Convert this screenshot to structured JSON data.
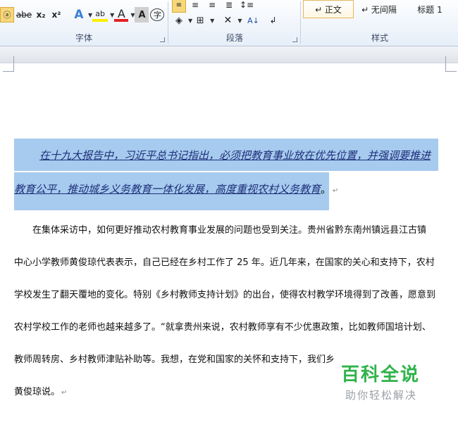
{
  "ribbon": {
    "font_group": {
      "label": "字体",
      "buttons": [
        {
          "name": "char-case-button",
          "text": "abc"
        },
        {
          "name": "strikethrough-button",
          "text": "abe"
        },
        {
          "name": "subscript-button",
          "text": "x₂"
        },
        {
          "name": "superscript-button",
          "text": "x²"
        },
        {
          "name": "text-effects-button",
          "text": "A"
        },
        {
          "name": "highlight-button",
          "text": "ab"
        },
        {
          "name": "font-color-button",
          "text": "A"
        },
        {
          "name": "char-shading-button",
          "text": "A"
        },
        {
          "name": "enclose-char-button",
          "text": "字"
        }
      ]
    },
    "paragraph_group": {
      "label": "段落"
    },
    "styles_group": {
      "label": "样式",
      "items": [
        "↵ 正文",
        "↵ 无间隔",
        "标题 1"
      ]
    }
  },
  "document": {
    "selected_line1": "在十九大报告中，习近平总书记指出，必须把教育事业放在优先位置，并强调要推进",
    "selected_line2": "教育公平，推动城乡义务教育一体化发展，高度重视农村义务教育",
    "selected_line2_end": "。",
    "para_mark": "↵",
    "lines": [
      "　　在集体采访中，如何更好推动农村教育事业发展的问题也受到关注。贵州省黔东南州镇远县江古镇",
      "中心小学教师黄俊琼代表表示，自己已经在乡村工作了 25 年。近几年来，在国家的关心和支持下，农村",
      "学校发生了翻天覆地的变化。特别《乡村教师支持计划》的出台，使得农村教学环境得到了改善，愿意到",
      "农村学校工作的老师也越来越多了。“就拿贵州来说，农村教师享有不少优惠政策，比如教师国培计划、",
      "教师周转房、乡村教师津贴补助等。我想，在党和国家的关怀和支持下，我们乡"
    ],
    "last_line": "黄俊琼说。"
  },
  "watermark": {
    "title": "百科全说",
    "subtitle": "助你轻松解决"
  }
}
